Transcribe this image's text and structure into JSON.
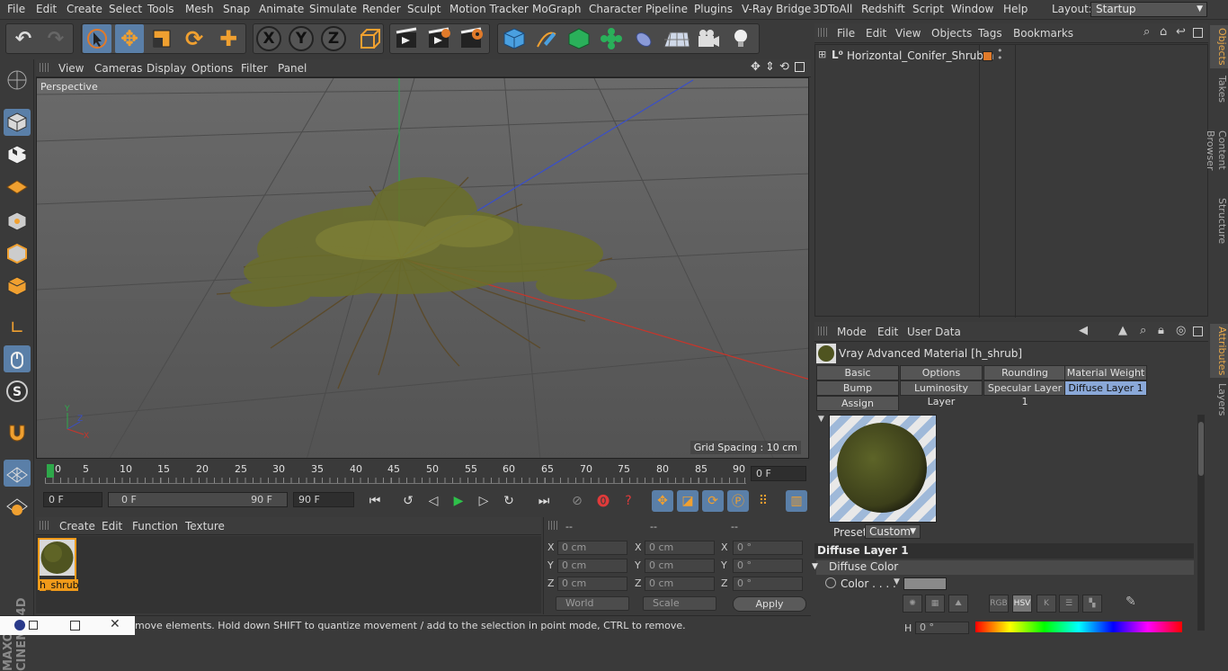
{
  "menubar": {
    "items": [
      "File",
      "Edit",
      "Create",
      "Select",
      "Tools",
      "Mesh",
      "Snap",
      "Animate",
      "Simulate",
      "Render",
      "Sculpt",
      "Motion Tracker",
      "MoGraph",
      "Character",
      "Pipeline",
      "Plugins",
      "V-Ray Bridge",
      "3DToAll",
      "Redshift",
      "Script",
      "Window",
      "Help"
    ],
    "layout_label": "Layout:",
    "layout_value": "Startup"
  },
  "viewport": {
    "menu": [
      "View",
      "Cameras",
      "Display",
      "Options",
      "Filter",
      "Panel"
    ],
    "camera_label": "Perspective",
    "grid_spacing": "Grid Spacing : 10 cm"
  },
  "timeline": {
    "ticks": [
      "0",
      "5",
      "10",
      "15",
      "20",
      "25",
      "30",
      "35",
      "40",
      "45",
      "50",
      "55",
      "60",
      "65",
      "70",
      "75",
      "80",
      "85",
      "90"
    ],
    "current_frame": "0 F",
    "start_field": "0 F",
    "range_start": "0 F",
    "range_end": "90 F",
    "end_field": "90 F"
  },
  "material_manager": {
    "menu": [
      "Create",
      "Edit",
      "Function",
      "Texture"
    ],
    "material_name": "h_shrub"
  },
  "coordinates": {
    "headers": [
      "--",
      "--",
      "--"
    ],
    "rows": [
      {
        "pos_label": "X",
        "pos": "0 cm",
        "size_label": "X",
        "size": "0 cm",
        "rot_label": "X",
        "rot": "0 °"
      },
      {
        "pos_label": "Y",
        "pos": "0 cm",
        "size_label": "Y",
        "size": "0 cm",
        "rot_label": "Y",
        "rot": "0 °"
      },
      {
        "pos_label": "Z",
        "pos": "0 cm",
        "size_label": "Z",
        "size": "0 cm",
        "rot_label": "Z",
        "rot": "0 °"
      }
    ],
    "space": "World",
    "mode": "Scale",
    "apply": "Apply"
  },
  "status": {
    "text": "move elements. Hold down SHIFT to quantize movement / add to the selection in point mode, CTRL to remove."
  },
  "object_manager": {
    "menu": [
      "File",
      "Edit",
      "View",
      "Objects",
      "Tags",
      "Bookmarks"
    ],
    "object_name": "Horizontal_Conifer_Shrubm"
  },
  "right_tabs": {
    "top": [
      "Objects",
      "Takes",
      "Content Browser",
      "Structure"
    ],
    "bottom": [
      "Attributes",
      "Layers"
    ]
  },
  "attributes": {
    "menu": [
      "Mode",
      "Edit",
      "User Data"
    ],
    "title": "Vray Advanced Material [h_shrub]",
    "tabs_row1": [
      "Basic",
      "Options",
      "Rounding",
      "Material Weight"
    ],
    "tabs_row2": [
      "Bump",
      "Luminosity Layer",
      "Specular Layer 1",
      "Diffuse Layer 1"
    ],
    "tabs_row3": [
      "Assign"
    ],
    "preset_label": "Preset",
    "preset_value": "Custom",
    "section": "Diffuse Layer 1",
    "subsection": "Diffuse Color",
    "color_label": "Color . . . .",
    "mode_buttons": [
      "RGB",
      "HSV",
      "K"
    ],
    "h_label": "H",
    "h_value": "0 °"
  },
  "colors": {
    "accent": "#f09a1a",
    "selected_tab": "#8aa8d8",
    "axis_x": "#c8352a",
    "axis_y": "#2ea84a",
    "axis_z": "#3a4fc8"
  }
}
